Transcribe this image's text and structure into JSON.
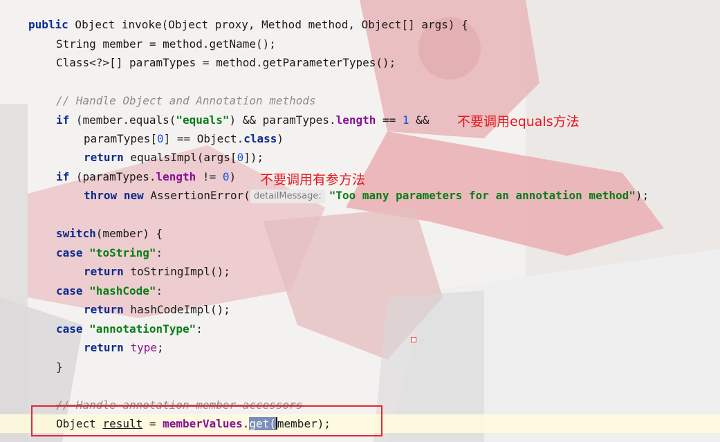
{
  "code": {
    "l1": {
      "kw": "public",
      "rest": " Object invoke(Object proxy, Method method, Object[] args) {"
    },
    "l2": "String member = method.getName();",
    "l3": "Class<?>[] paramTypes = method.getParameterTypes();",
    "l4": "// Handle Object and Annotation methods",
    "l5": {
      "kw": "if",
      "a": " (member.equals(",
      "str": "\"equals\"",
      "b": ") && paramTypes.",
      "fld": "length",
      "c": " == ",
      "num": "1",
      "d": " &&"
    },
    "l6": {
      "a": "paramTypes[",
      "num": "0",
      "b": "] == Object.",
      "kw": "class",
      "c": ")"
    },
    "l7": {
      "kw": "return",
      "a": " equalsImpl(args[",
      "num": "0",
      "b": "]);"
    },
    "l8": {
      "kw": "if",
      "a": " (paramTypes.",
      "fld": "length",
      "b": " != ",
      "num": "0",
      "c": ")"
    },
    "l9": {
      "kw1": "throw",
      "kw2": "new",
      "a": " AssertionError(",
      "hint": "detailMessage:",
      "str": "\"Too many parameters for an annotation method\"",
      "b": ");"
    },
    "l10": {
      "kw": "switch",
      "a": "(member) {"
    },
    "l11": {
      "kw": "case",
      "str": "\"toString\"",
      "a": ":"
    },
    "l12": {
      "kw": "return",
      "a": " toStringImpl();"
    },
    "l13": {
      "kw": "case",
      "str": "\"hashCode\"",
      "a": ":"
    },
    "l14": {
      "kw": "return",
      "a": " hashCodeImpl();"
    },
    "l15": {
      "kw": "case",
      "str": "\"annotationType\"",
      "a": ":"
    },
    "l16": {
      "kw": "return",
      "fld": "type",
      "a": ";"
    },
    "l17": "}",
    "l18": "// Handle annotation member accessors",
    "l19": {
      "a": "Object ",
      "ul": "result",
      "b": " = ",
      "fld": "memberValues",
      "c": ".",
      "sel": "get(",
      "d": "member);"
    }
  },
  "annotations": {
    "note1": "不要调用equals方法",
    "note2": "不要调用有参方法"
  },
  "colors": {
    "keyword": "#0b2a8e",
    "string": "#067d17",
    "number": "#1750eb",
    "field": "#871094",
    "comment": "#8c8c8c",
    "annotation_red": "#e8141c"
  }
}
